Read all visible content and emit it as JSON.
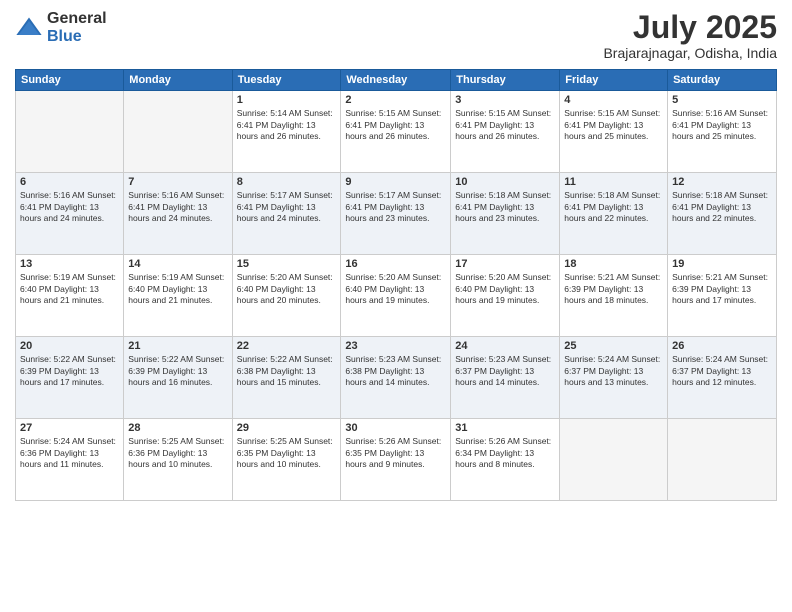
{
  "logo": {
    "general": "General",
    "blue": "Blue"
  },
  "title": "July 2025",
  "subtitle": "Brajarajnagar, Odisha, India",
  "headers": [
    "Sunday",
    "Monday",
    "Tuesday",
    "Wednesday",
    "Thursday",
    "Friday",
    "Saturday"
  ],
  "weeks": [
    [
      {
        "day": "",
        "info": ""
      },
      {
        "day": "",
        "info": ""
      },
      {
        "day": "1",
        "info": "Sunrise: 5:14 AM\nSunset: 6:41 PM\nDaylight: 13 hours and 26 minutes."
      },
      {
        "day": "2",
        "info": "Sunrise: 5:15 AM\nSunset: 6:41 PM\nDaylight: 13 hours and 26 minutes."
      },
      {
        "day": "3",
        "info": "Sunrise: 5:15 AM\nSunset: 6:41 PM\nDaylight: 13 hours and 26 minutes."
      },
      {
        "day": "4",
        "info": "Sunrise: 5:15 AM\nSunset: 6:41 PM\nDaylight: 13 hours and 25 minutes."
      },
      {
        "day": "5",
        "info": "Sunrise: 5:16 AM\nSunset: 6:41 PM\nDaylight: 13 hours and 25 minutes."
      }
    ],
    [
      {
        "day": "6",
        "info": "Sunrise: 5:16 AM\nSunset: 6:41 PM\nDaylight: 13 hours and 24 minutes."
      },
      {
        "day": "7",
        "info": "Sunrise: 5:16 AM\nSunset: 6:41 PM\nDaylight: 13 hours and 24 minutes."
      },
      {
        "day": "8",
        "info": "Sunrise: 5:17 AM\nSunset: 6:41 PM\nDaylight: 13 hours and 24 minutes."
      },
      {
        "day": "9",
        "info": "Sunrise: 5:17 AM\nSunset: 6:41 PM\nDaylight: 13 hours and 23 minutes."
      },
      {
        "day": "10",
        "info": "Sunrise: 5:18 AM\nSunset: 6:41 PM\nDaylight: 13 hours and 23 minutes."
      },
      {
        "day": "11",
        "info": "Sunrise: 5:18 AM\nSunset: 6:41 PM\nDaylight: 13 hours and 22 minutes."
      },
      {
        "day": "12",
        "info": "Sunrise: 5:18 AM\nSunset: 6:41 PM\nDaylight: 13 hours and 22 minutes."
      }
    ],
    [
      {
        "day": "13",
        "info": "Sunrise: 5:19 AM\nSunset: 6:40 PM\nDaylight: 13 hours and 21 minutes."
      },
      {
        "day": "14",
        "info": "Sunrise: 5:19 AM\nSunset: 6:40 PM\nDaylight: 13 hours and 21 minutes."
      },
      {
        "day": "15",
        "info": "Sunrise: 5:20 AM\nSunset: 6:40 PM\nDaylight: 13 hours and 20 minutes."
      },
      {
        "day": "16",
        "info": "Sunrise: 5:20 AM\nSunset: 6:40 PM\nDaylight: 13 hours and 19 minutes."
      },
      {
        "day": "17",
        "info": "Sunrise: 5:20 AM\nSunset: 6:40 PM\nDaylight: 13 hours and 19 minutes."
      },
      {
        "day": "18",
        "info": "Sunrise: 5:21 AM\nSunset: 6:39 PM\nDaylight: 13 hours and 18 minutes."
      },
      {
        "day": "19",
        "info": "Sunrise: 5:21 AM\nSunset: 6:39 PM\nDaylight: 13 hours and 17 minutes."
      }
    ],
    [
      {
        "day": "20",
        "info": "Sunrise: 5:22 AM\nSunset: 6:39 PM\nDaylight: 13 hours and 17 minutes."
      },
      {
        "day": "21",
        "info": "Sunrise: 5:22 AM\nSunset: 6:39 PM\nDaylight: 13 hours and 16 minutes."
      },
      {
        "day": "22",
        "info": "Sunrise: 5:22 AM\nSunset: 6:38 PM\nDaylight: 13 hours and 15 minutes."
      },
      {
        "day": "23",
        "info": "Sunrise: 5:23 AM\nSunset: 6:38 PM\nDaylight: 13 hours and 14 minutes."
      },
      {
        "day": "24",
        "info": "Sunrise: 5:23 AM\nSunset: 6:37 PM\nDaylight: 13 hours and 14 minutes."
      },
      {
        "day": "25",
        "info": "Sunrise: 5:24 AM\nSunset: 6:37 PM\nDaylight: 13 hours and 13 minutes."
      },
      {
        "day": "26",
        "info": "Sunrise: 5:24 AM\nSunset: 6:37 PM\nDaylight: 13 hours and 12 minutes."
      }
    ],
    [
      {
        "day": "27",
        "info": "Sunrise: 5:24 AM\nSunset: 6:36 PM\nDaylight: 13 hours and 11 minutes."
      },
      {
        "day": "28",
        "info": "Sunrise: 5:25 AM\nSunset: 6:36 PM\nDaylight: 13 hours and 10 minutes."
      },
      {
        "day": "29",
        "info": "Sunrise: 5:25 AM\nSunset: 6:35 PM\nDaylight: 13 hours and 10 minutes."
      },
      {
        "day": "30",
        "info": "Sunrise: 5:26 AM\nSunset: 6:35 PM\nDaylight: 13 hours and 9 minutes."
      },
      {
        "day": "31",
        "info": "Sunrise: 5:26 AM\nSunset: 6:34 PM\nDaylight: 13 hours and 8 minutes."
      },
      {
        "day": "",
        "info": ""
      },
      {
        "day": "",
        "info": ""
      }
    ]
  ]
}
